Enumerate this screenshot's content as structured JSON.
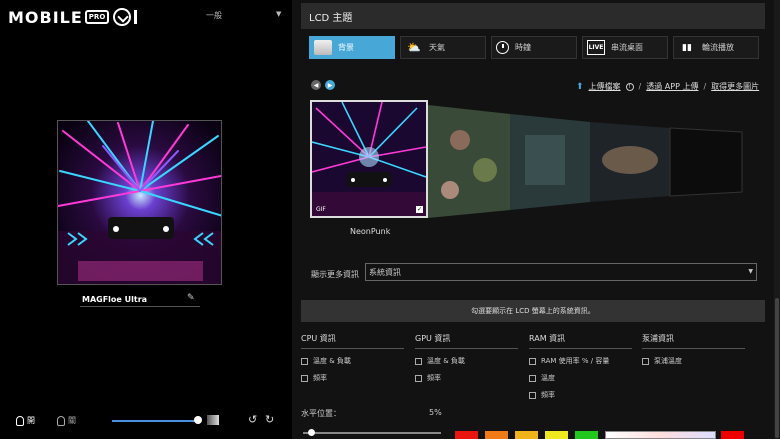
{
  "left": {
    "logo": {
      "prefix": "MOBILE",
      "badge": "PRO"
    },
    "mode": "一般",
    "device_name": "MAGFloe Ultra",
    "light_on_label": "開",
    "light_off_label": "關",
    "brightness": 0.95
  },
  "right": {
    "section_title": "LCD 主題",
    "tabs": [
      {
        "label": "背景",
        "icon": "image-icon",
        "active": true
      },
      {
        "label": "天氣",
        "icon": "weather-icon",
        "active": false
      },
      {
        "label": "時鐘",
        "icon": "clock-icon",
        "active": false
      },
      {
        "label": "串流桌面",
        "icon": "live-icon",
        "active": false
      },
      {
        "label": "輪流播放",
        "icon": "slideshow-icon",
        "active": false
      }
    ],
    "links": {
      "upload": "上傳檔案",
      "app_upload": "透過 APP 上傳",
      "more_images": "取得更多圖片"
    },
    "thumb": {
      "badge": "GIF",
      "name": "NeonPunk"
    },
    "more_info": {
      "label": "顯示更多資訊",
      "selected": "系統資訊"
    },
    "notice": "勾選要顯示在 LCD 螢幕上的系統資訊。",
    "columns": [
      {
        "title": "CPU 資訊",
        "options": [
          "溫度 & 負載",
          "頻率"
        ]
      },
      {
        "title": "GPU 資訊",
        "options": [
          "溫度 & 負載",
          "頻率"
        ]
      },
      {
        "title": "RAM 資訊",
        "options": [
          "RAM 使用率 % / 容量",
          "溫度",
          "頻率"
        ]
      },
      {
        "title": "泵浦資訊",
        "options": [
          "泵浦溫度"
        ]
      }
    ],
    "position": {
      "label": "水平位置：",
      "value": "5%"
    },
    "swatch_colors": [
      "#e8160f",
      "#f07a16",
      "#f0b41a",
      "#f0e81e",
      "#20c81e"
    ]
  }
}
